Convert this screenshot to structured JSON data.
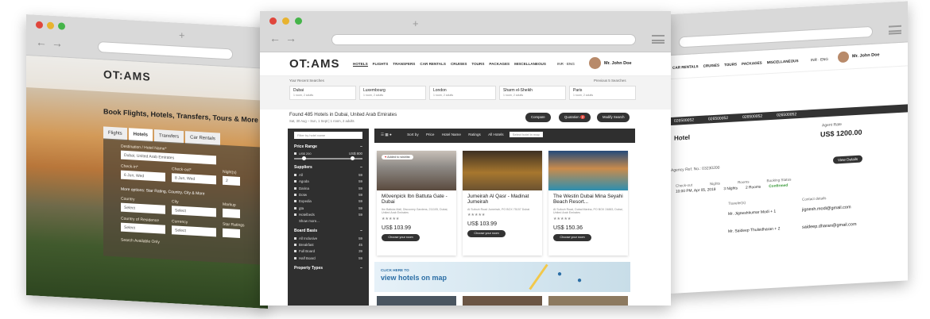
{
  "left": {
    "title": "Book Flights, Hotels, Transfers, Tours & More",
    "tabs": [
      "Flights",
      "Hotels",
      "Transfers",
      "Car Rentals"
    ],
    "dest_label": "Destination / Hotel Name*",
    "dest_value": "Dubai, United Arab Emirates",
    "checkin_label": "Check-in*",
    "checkin_value": "6 Jun, Wed",
    "checkout_label": "Check-out*",
    "checkout_value": "8 Jun, Wed",
    "nights_label": "Night(s)",
    "nights_value": "2",
    "more": "More options: Star Rating, Country, City & More",
    "country_label": "Country",
    "city_label": "City",
    "markup_label": "Markup",
    "residence_label": "Country of Residence",
    "currency_label": "Currency",
    "star_label": "Star Ratings",
    "select": "Select",
    "available": "Search Available Only"
  },
  "center": {
    "logo": "OT:AMS",
    "menu": [
      "HOTELS",
      "FLIGHTS",
      "TRANSFERS",
      "CAR RENTALS",
      "CRUISES",
      "TOURS",
      "PACKAGES",
      "MISCELLANEOUS"
    ],
    "lang": "INR · ENG",
    "user": "Mr. John Doe",
    "recent_label": "Your Recent Searches",
    "prev_label": "Previous 5 Searches",
    "recent": [
      {
        "city": "Dubai",
        "sub": "1 room, 2 adults"
      },
      {
        "city": "Luxembourg",
        "sub": "1 room, 2 adults"
      },
      {
        "city": "London",
        "sub": "1 room, 2 adults"
      },
      {
        "city": "Sharm el-Sheikh",
        "sub": "1 room, 2 adults"
      },
      {
        "city": "Paris",
        "sub": "1 room, 2 adults"
      }
    ],
    "found": "Found 485 Hotels in Dubai, United Arab Emirates",
    "found_sub": "Sat, 30 Aug – Sun, 1 Sept | 1 room, 2 adults",
    "compare": "Compare",
    "quotation": "Quotation",
    "quotation_count": "2",
    "modify": "Modify Search",
    "filter_placeholder": "Filter by hotel name",
    "price_range": "Price Range",
    "price_min": "US$ 200",
    "price_max": "US$ 800",
    "suppliers": "Suppliers",
    "supplier_rows": [
      [
        "All",
        "59"
      ],
      [
        "Agoda",
        "59"
      ],
      [
        "Darina",
        "59"
      ],
      [
        "Dotw",
        "59"
      ],
      [
        "Expedia",
        "59"
      ],
      [
        "gta",
        "59"
      ],
      [
        "Hotelbeds",
        "59"
      ]
    ],
    "show_more": "Show more...",
    "board": "Board Basis",
    "board_rows": [
      [
        "All Inclusive",
        "59"
      ],
      [
        "Breakfast",
        "45"
      ],
      [
        "Full Board",
        "39"
      ],
      [
        "Half Board",
        "59"
      ]
    ],
    "property": "Property Types",
    "sort": [
      "Sort by",
      "Price",
      "Hotel Name",
      "Ratings",
      "All Hotels"
    ],
    "map_search": "Select hotel in map",
    "added": "Added to wishlist",
    "choose": "Choose your room",
    "hotels": [
      {
        "name": "Mövenpick Ibn Battuta Gate - Dubai",
        "addr": "Ibn Battuta Mall, Discovery Gardens, 211105, Dubai, United Arab Emirates",
        "price": "US$ 103.99"
      },
      {
        "name": "Jumeirah Al Qasr - Madinat Jumeirah",
        "addr": "Al Sufouh Road Jumeirah, PO BOX 75157 Dubai",
        "price": "US$ 103.99"
      },
      {
        "name": "The Westin Dubai Mina Seyahi Beach Resort...",
        "addr": "Al Sufouh Road, Dubai Marina, PO BOX 24883, Dubai, United Arab Emirates",
        "price": "US$ 150.36"
      }
    ],
    "map_click": "CLICK HERE TO",
    "map_view": "view hotels on map"
  },
  "right": {
    "refs": [
      "026500052",
      "026500052",
      "026500052",
      "026500052"
    ],
    "hotel": "Hotel",
    "agent_rate": "Agent Rate",
    "rate": "US$ 1200.00",
    "ref_text": "Agency Ref. No.: 03230200",
    "view": "View Details",
    "checkout_label": "Check-out",
    "checkout_val": "10:00 PM, Apr 05, 2019",
    "nights_label": "Nights",
    "nights_val": "3 Nights",
    "rooms_label": "Rooms",
    "rooms_val": "2 Rooms",
    "status_label": "Booking Status",
    "status_val": "Confirmed",
    "traveler_label": "Traveler(s)",
    "contact_label": "Contact details",
    "t1": "Mr. Jigneshkumar Modi + 1",
    "e1": "jignesh.modi@gmail.com",
    "t2": "Mr. Saideep Thulsidharan + 2",
    "e2": "saideep.dharan@gmail.com"
  }
}
